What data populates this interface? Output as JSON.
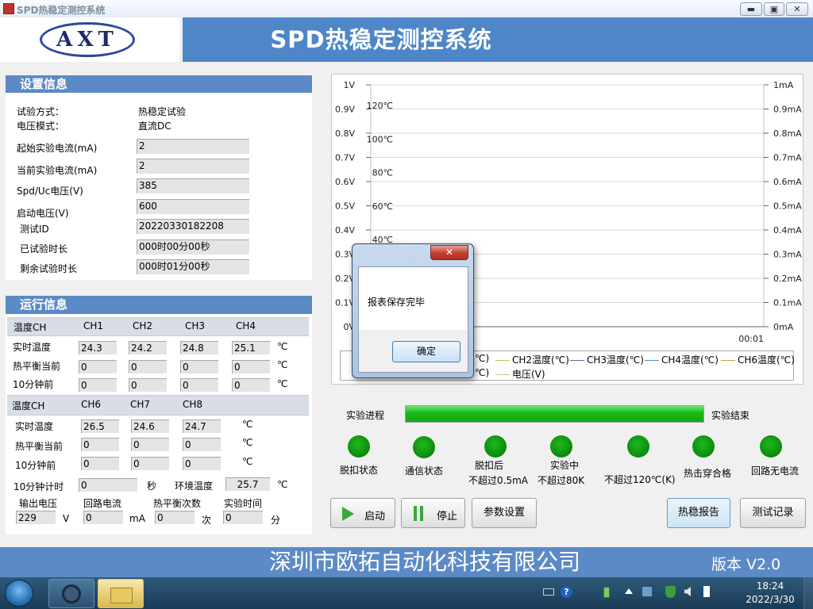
{
  "window": {
    "title": "SPD热稳定测控系统",
    "min_label": "▬",
    "restore_label": "▣",
    "close_label": "✕"
  },
  "header": {
    "logo_text": "AXT",
    "title": "SPD热稳定测控系统"
  },
  "settings": {
    "heading": "设置信息",
    "test_mode_label": "试验方式：",
    "test_mode_value": "热稳定试验",
    "voltage_mode_label": "电压模式：",
    "voltage_mode_value": "直流DC",
    "start_current_label": "起始实验电流(mA)",
    "start_current_value": "2",
    "current_current_label": "当前实验电流(mA)",
    "current_current_value": "2",
    "uc_label": "Spd/Uc电压(V)",
    "uc_value": "385",
    "start_voltage_label": "启动电压(V)",
    "start_voltage_value": "600",
    "test_id_label": "测试ID",
    "test_id_value": "20220330182208",
    "elapsed_label": "已试验时长",
    "elapsed_value": "000时00分00秒",
    "remaining_label": "剩余试验时长",
    "remaining_value": "000时01分00秒"
  },
  "running": {
    "heading": "运行信息",
    "group1": {
      "head_label": "温度CH",
      "channels": [
        "CH1",
        "CH2",
        "CH3",
        "CH4"
      ],
      "rows": [
        {
          "label": "实时温度",
          "values": [
            "24.3",
            "24.2",
            "24.8",
            "25.1"
          ],
          "unit": "℃"
        },
        {
          "label": "热平衡当前",
          "values": [
            "0",
            "0",
            "0",
            "0"
          ],
          "unit": "℃"
        },
        {
          "label": "10分钟前",
          "values": [
            "0",
            "0",
            "0",
            "0"
          ],
          "unit": "℃"
        }
      ]
    },
    "group2": {
      "head_label": "温度CH",
      "channels": [
        "CH6",
        "CH7",
        "CH8"
      ],
      "rows": [
        {
          "label": "实时温度",
          "values": [
            "26.5",
            "24.6",
            "24.7"
          ],
          "unit": "℃"
        },
        {
          "label": "热平衡当前",
          "values": [
            "0",
            "0",
            "0"
          ],
          "unit": "℃"
        },
        {
          "label": "10分钟前",
          "values": [
            "0",
            "0",
            "0"
          ],
          "unit": "℃"
        }
      ]
    },
    "timer_label": "10分钟计时",
    "timer_value": "0",
    "timer_unit": "秒",
    "ambient_label": "环境温度",
    "ambient_value": "25.7",
    "ambient_unit": "℃",
    "out_voltage_label": "输出电压",
    "out_voltage_value": "229",
    "out_voltage_unit": "V",
    "loop_current_label": "回路电流",
    "loop_current_value": "0",
    "loop_current_unit": "mA",
    "balance_count_label": "热平衡次数",
    "balance_count_value": "0",
    "balance_count_unit": "次",
    "test_time_label": "实验时间",
    "test_time_value": "0",
    "test_time_unit": "分"
  },
  "chart_data": {
    "type": "line",
    "y_left_ticks": [
      "1V",
      "0.9V",
      "0.8V",
      "0.7V",
      "0.6V",
      "0.5V",
      "0.4V",
      "0.3V",
      "0.2V",
      "0.1V",
      "0V"
    ],
    "y_right_ticks": [
      "1mA",
      "0.9mA",
      "0.8mA",
      "0.7mA",
      "0.6mA",
      "0.5mA",
      "0.4mA",
      "0.3mA",
      "0.2mA",
      "0.1mA",
      "0mA"
    ],
    "temp_ticks": [
      "120℃",
      "100℃",
      "80℃",
      "60℃",
      "40℃"
    ],
    "x_tick": "00:01",
    "ylim_voltage": [
      0,
      1
    ],
    "ylim_current": [
      0,
      1
    ],
    "grid": true,
    "legend_position": "bottom",
    "series": [
      {
        "name": "CH2温度(℃)",
        "values": [],
        "color": "#c8c060"
      },
      {
        "name": "CH3温度(℃)",
        "values": [],
        "color": "#7a5a9a"
      },
      {
        "name": "CH4温度(℃)",
        "values": [],
        "color": "#4a90c8"
      },
      {
        "name": "CH6温度(℃)",
        "values": [],
        "color": "#c0a040"
      },
      {
        "name": "电压(V)",
        "values": [],
        "color": "#d0c880"
      }
    ],
    "legend_partial_1": "℃)",
    "legend_partial_2": "℃)"
  },
  "progress": {
    "label": "实验进程",
    "fraction": 1.0,
    "end_label": "实验结束",
    "fill_color": "#22c422"
  },
  "indicators": [
    {
      "line1": "脱扣状态",
      "line2": ""
    },
    {
      "line1": "通信状态",
      "line2": ""
    },
    {
      "line1": "脱扣后",
      "line2": "不超过0.5mA"
    },
    {
      "line1": "实验中",
      "line2": "不超过80K"
    },
    {
      "line1": "",
      "line2": "不超过120℃(K)"
    },
    {
      "line1": "热击穿合格",
      "line2": ""
    },
    {
      "line1": "回路无电流",
      "line2": ""
    }
  ],
  "buttons": {
    "start": "启动",
    "stop": "停止",
    "params": "参数设置",
    "report": "热稳报告",
    "records": "测试记录"
  },
  "footer": {
    "company": "深圳市欧拓自动化科技有限公司",
    "version": "版本 V2.0"
  },
  "dialog": {
    "close_label": "✕",
    "message": "报表保存完毕",
    "ok_label": "确定"
  },
  "taskbar": {
    "time": "18:24",
    "date": "2022/3/30"
  },
  "colors": {
    "header_blue": "#4f86c8",
    "section_blue": "#5b8ac6",
    "led_green": "#0b8a0b"
  }
}
